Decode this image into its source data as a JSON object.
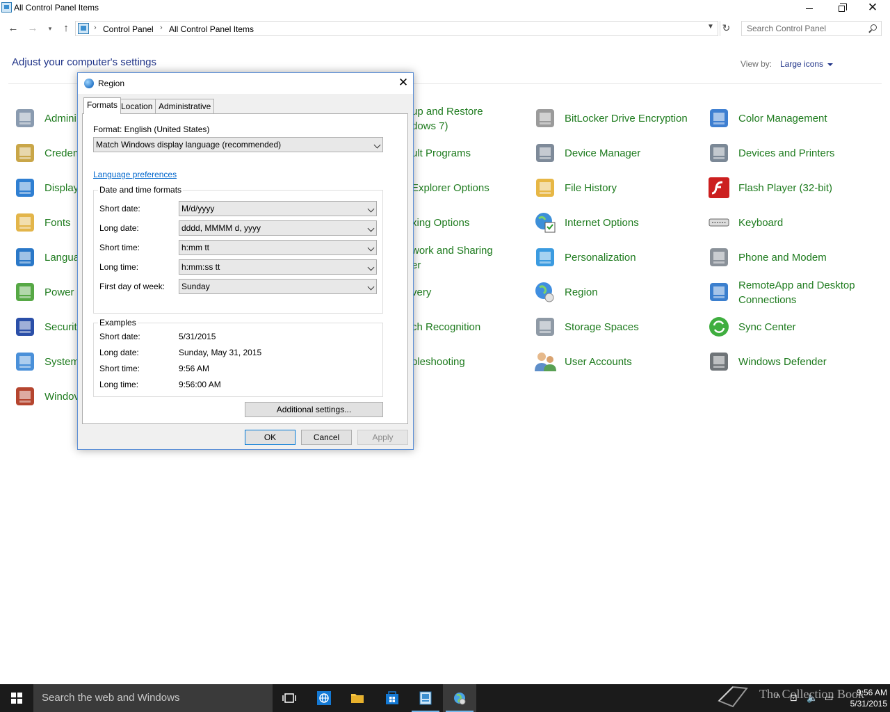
{
  "window": {
    "title": "All Control Panel Items"
  },
  "navigation": {
    "breadcrumbs": [
      "Control Panel",
      "All Control Panel Items"
    ],
    "search_placeholder": "Search Control Panel"
  },
  "header": {
    "heading": "Adjust your computer's settings",
    "view_by_label": "View by:",
    "view_by_value": "Large icons"
  },
  "items": [
    {
      "label": "Admini",
      "icon": "administrative-tools-icon"
    },
    {
      "label": "Creden",
      "icon": "credential-manager-icon"
    },
    {
      "label": "Display",
      "icon": "display-icon"
    },
    {
      "label": "Fonts",
      "icon": "fonts-icon"
    },
    {
      "label": "Langua",
      "icon": "language-icon"
    },
    {
      "label": "Power",
      "icon": "power-options-icon"
    },
    {
      "label": "Securit",
      "icon": "security-maintenance-icon"
    },
    {
      "label": "System",
      "icon": "system-icon"
    },
    {
      "label": "Windov",
      "icon": "windows-firewall-icon"
    },
    {
      "label": "up and Restore\ndows 7)",
      "icon": "backup-restore-icon"
    },
    {
      "label": "ult Programs",
      "icon": "default-programs-icon"
    },
    {
      "label": "Explorer Options",
      "icon": "file-explorer-options-icon"
    },
    {
      "label": "xing Options",
      "icon": "indexing-options-icon"
    },
    {
      "label": "work and Sharing\ner",
      "icon": "network-sharing-icon"
    },
    {
      "label": "very",
      "icon": "recovery-icon"
    },
    {
      "label": "ch Recognition",
      "icon": "speech-recognition-icon"
    },
    {
      "label": "bleshooting",
      "icon": "troubleshooting-icon"
    },
    {
      "label": "BitLocker Drive Encryption",
      "icon": "bitlocker-icon"
    },
    {
      "label": "Device Manager",
      "icon": "device-manager-icon"
    },
    {
      "label": "File History",
      "icon": "file-history-icon"
    },
    {
      "label": "Internet Options",
      "icon": "internet-options-icon"
    },
    {
      "label": "Personalization",
      "icon": "personalization-icon"
    },
    {
      "label": "Region",
      "icon": "region-icon"
    },
    {
      "label": "Storage Spaces",
      "icon": "storage-spaces-icon"
    },
    {
      "label": "User Accounts",
      "icon": "user-accounts-icon"
    },
    {
      "label": "Color Management",
      "icon": "color-management-icon"
    },
    {
      "label": "Devices and Printers",
      "icon": "devices-printers-icon"
    },
    {
      "label": "Flash Player (32-bit)",
      "icon": "flash-player-icon"
    },
    {
      "label": "Keyboard",
      "icon": "keyboard-icon"
    },
    {
      "label": "Phone and Modem",
      "icon": "phone-modem-icon"
    },
    {
      "label": "RemoteApp and Desktop\nConnections",
      "icon": "remoteapp-icon"
    },
    {
      "label": "Sync Center",
      "icon": "sync-center-icon"
    },
    {
      "label": "Windows Defender",
      "icon": "windows-defender-icon"
    }
  ],
  "dialog": {
    "title": "Region",
    "close_glyph": "✕",
    "tabs": [
      "Formats",
      "Location",
      "Administrative"
    ],
    "active_tab": "Formats",
    "format_label": "Format: English (United States)",
    "format_value": "Match Windows display language (recommended)",
    "language_link": "Language preferences",
    "date_time_group": "Date and time formats",
    "fields": [
      {
        "label": "Short date:",
        "value": "M/d/yyyy"
      },
      {
        "label": "Long date:",
        "value": "dddd, MMMM d, yyyy"
      },
      {
        "label": "Short time:",
        "value": "h:mm tt"
      },
      {
        "label": "Long time:",
        "value": "h:mm:ss tt"
      },
      {
        "label": "First day of week:",
        "value": "Sunday"
      }
    ],
    "examples_group": "Examples",
    "examples": [
      {
        "label": "Short date:",
        "value": "5/31/2015"
      },
      {
        "label": "Long date:",
        "value": "Sunday, May 31, 2015"
      },
      {
        "label": "Short time:",
        "value": "9:56 AM"
      },
      {
        "label": "Long time:",
        "value": "9:56:00 AM"
      }
    ],
    "additional_settings": "Additional settings...",
    "ok": "OK",
    "cancel": "Cancel",
    "apply": "Apply"
  },
  "taskbar": {
    "search_placeholder": "Search the web and Windows",
    "time": "9:56 AM",
    "date": "5/31/2015",
    "watermark": "The Collection Book"
  },
  "colors": {
    "link_green": "#1e7b1e",
    "heading_blue": "#1e3287",
    "taskbar": "#1b1b1b",
    "accent": "#0078d7"
  }
}
